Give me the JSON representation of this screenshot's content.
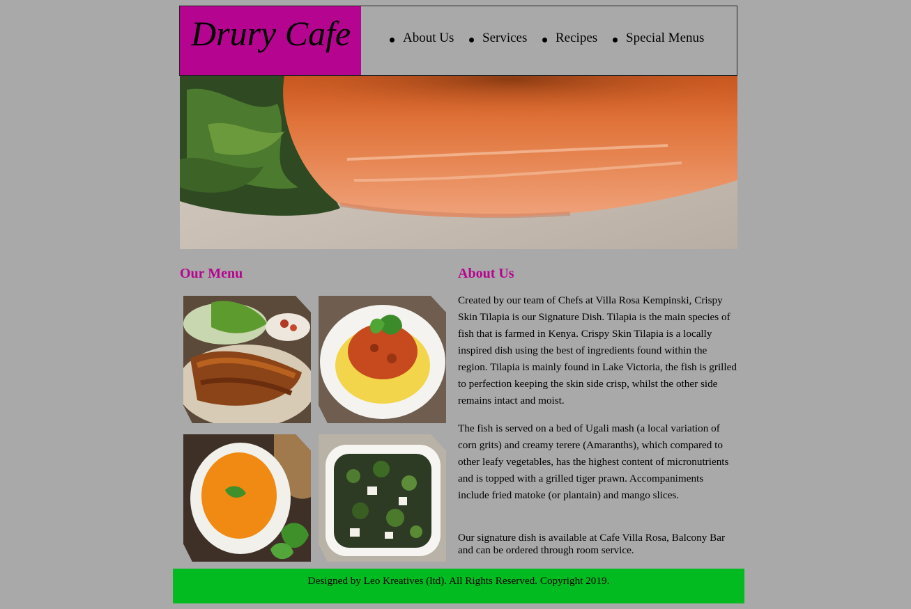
{
  "header": {
    "logo": "Drury Cafe",
    "nav": [
      "About Us",
      "Services",
      "Recipes",
      "Special Menus"
    ]
  },
  "hero": {
    "image": "grilled-salmon-photo"
  },
  "menu": {
    "title": "Our Menu",
    "items": [
      {
        "image": "grilled-chicken-photo"
      },
      {
        "image": "spaghetti-bolognese-photo"
      },
      {
        "image": "pumpkin-soup-photo"
      },
      {
        "image": "salad-bowl-photo"
      }
    ]
  },
  "about": {
    "title": "About Us",
    "paragraphs": [
      "Created by our team of Chefs at Villa Rosa Kempinski, Crispy Skin Tilapia is our Signature Dish. Tilapia is the main species of fish that is farmed in Kenya. Crispy Skin Tilapia is a locally inspired dish using the best of ingredients found within the region. Tilapia is mainly found in Lake Victoria, the fish is grilled to perfection keeping the skin side crisp, whilst the other side remains intact and moist.",
      "The fish is served on a bed of Ugali mash (a local variation of corn grits) and creamy terere (Amaranths), which compared to other leafy vegetables, has the highest content of micronutrients and is topped with a grilled tiger prawn. Accompaniments include fried matoke (or plantain) and mango slices.",
      "Our signature dish is available at Cafe Villa Rosa, Balcony Bar and can be ordered through room service."
    ]
  },
  "footer": {
    "text": "Designed by Leo Kreatives (ltd). All Rights Reserved. Copyright 2019."
  },
  "colors": {
    "brand": "#b5048f",
    "page_bg": "#a9a9a9",
    "footer_bg": "#02bb20"
  }
}
